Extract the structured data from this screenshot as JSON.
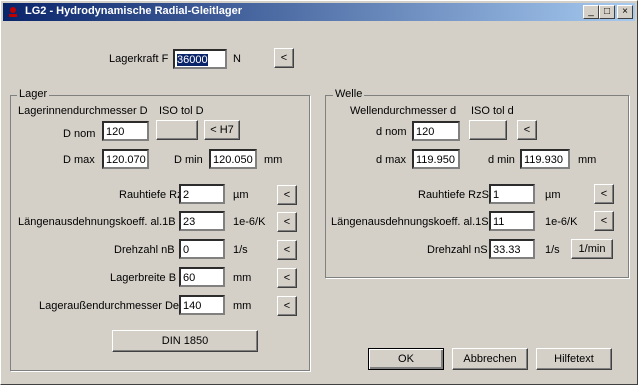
{
  "window": {
    "title": "LG2 - Hydrodynamische Radial-Gleitlager",
    "minimize": "_",
    "maximize": "□",
    "close": "×",
    "icon": "app-icon"
  },
  "top": {
    "force_label": "Lagerkraft F",
    "force_value": "36000",
    "force_unit": "N",
    "force_button": "<"
  },
  "lager": {
    "group_title": "Lager",
    "inner_diameter_label": "Lagerinnendurchmesser D",
    "iso_label": "ISO tol D",
    "d_nom_label": "D nom",
    "d_nom_value": "120",
    "iso_value": "",
    "iso_button": "< H7",
    "d_max_label": "D max",
    "d_max_value": "120.070",
    "d_min_label": "D min",
    "d_min_value": "120.050",
    "d_unit": "mm",
    "rauhtiefe_label": "Rauhtiefe RzB",
    "rauhtiefe_value": "2",
    "rauhtiefe_unit": "µm",
    "laengen_label": "Längenausdehnungskoeff. al.1B",
    "laengen_value": "23",
    "laengen_unit": "1e-6/K",
    "drehzahl_label": "Drehzahl nB",
    "drehzahl_value": "0",
    "drehzahl_unit": "1/s",
    "breite_label": "Lagerbreite B",
    "breite_value": "60",
    "breite_unit": "mm",
    "aussen_label": "Lageraußendurchmesser De",
    "aussen_value": "140",
    "aussen_unit": "mm",
    "arrow_button": "<",
    "din_button": "DIN 1850"
  },
  "welle": {
    "group_title": "Welle",
    "diameter_label": "Wellendurchmesser d",
    "iso_label": "ISO tol d",
    "d_nom_label": "d nom",
    "d_nom_value": "120",
    "iso_value": "",
    "iso_button": "<",
    "d_max_label": "d max",
    "d_max_value": "119.950",
    "d_min_label": "d min",
    "d_min_value": "119.930",
    "d_unit": "mm",
    "rauhtiefe_label": "Rauhtiefe RzS",
    "rauhtiefe_value": "1",
    "rauhtiefe_unit": "µm",
    "laengen_label": "Längenausdehnungskoeff. al.1S",
    "laengen_value": "11",
    "laengen_unit": "1e-6/K",
    "drehzahl_label": "Drehzahl nS",
    "drehzahl_value": "33.33",
    "drehzahl_unit": "1/s",
    "drehzahl_button": "1/min",
    "arrow_button": "<"
  },
  "footer": {
    "ok": "OK",
    "cancel": "Abbrechen",
    "help": "Hilfetext"
  }
}
